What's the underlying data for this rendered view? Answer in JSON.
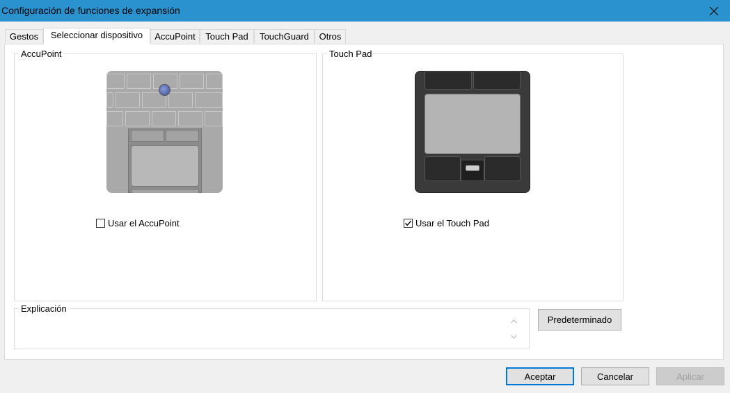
{
  "window": {
    "title": "Configuración de funciones de expansión"
  },
  "tabs": [
    {
      "label": "Gestos"
    },
    {
      "label": "Seleccionar dispositivo"
    },
    {
      "label": "AccuPoint"
    },
    {
      "label": "Touch Pad"
    },
    {
      "label": "TouchGuard"
    },
    {
      "label": "Otros"
    }
  ],
  "accupoint_group": {
    "title": "AccuPoint",
    "checkbox_label": "Usar el AccuPoint",
    "checked": false
  },
  "touchpad_group": {
    "title": "Touch Pad",
    "checkbox_label": "Usar el Touch Pad",
    "checked": true
  },
  "explanation": {
    "title": "Explicación",
    "text": ""
  },
  "buttons": {
    "default": "Predeterminado",
    "accept": "Aceptar",
    "cancel": "Cancelar",
    "apply": "Aplicar"
  },
  "icons": {
    "close": "close-icon",
    "scroll_up": "chevron-up-icon",
    "scroll_down": "chevron-down-icon"
  },
  "colors": {
    "titlebar": "#2b92d0",
    "accent": "#0078d7"
  }
}
